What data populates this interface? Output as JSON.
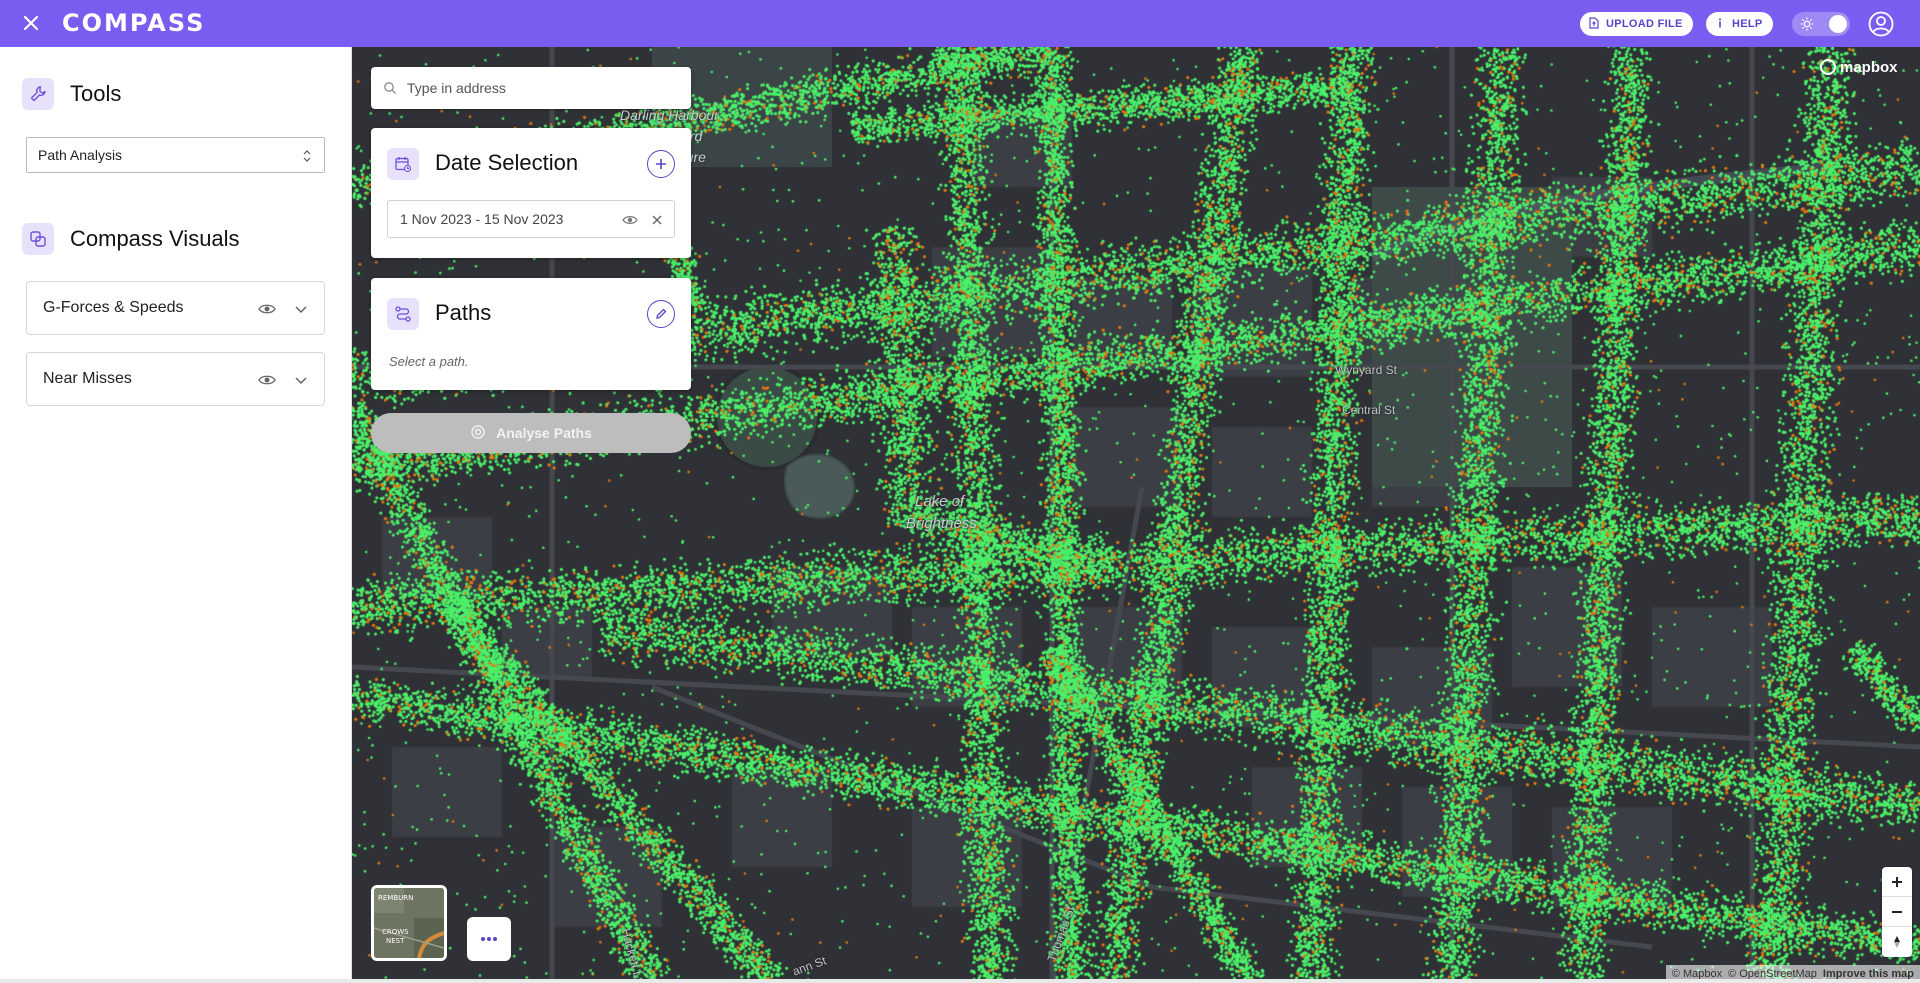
{
  "app": {
    "logo": "COMPASS",
    "accent": "#7b5cf0"
  },
  "header": {
    "close_icon": "close-icon",
    "upload_label": "UPLOAD FILE",
    "help_label": "HELP",
    "theme_icon": "sun-icon",
    "account_icon": "account-circle-icon"
  },
  "sidebar": {
    "tools_title": "Tools",
    "tool_select_value": "Path Analysis",
    "visuals_title": "Compass Visuals",
    "layers": [
      {
        "label": "G-Forces & Speeds"
      },
      {
        "label": "Near Misses"
      }
    ]
  },
  "map": {
    "search_placeholder": "Type in address",
    "date_panel": {
      "title": "Date Selection",
      "range": "1 Nov 2023 - 15 Nov 2023"
    },
    "paths_panel": {
      "title": "Paths",
      "placeholder": "Select a path."
    },
    "analyse_label": "Analyse Paths",
    "mapbox_logo": "mapbox",
    "attribution": {
      "mapbox": "© Mapbox",
      "osm": "© OpenStreetMap",
      "improve": "Improve this map"
    },
    "labels": {
      "darling": "Darling Harbour",
      "ard": "ard",
      "ature": "ature",
      "lake1": "Lake of",
      "lake2": "Brightness",
      "wynyard": "Wynyard St",
      "central": "Central St",
      "hackett": "Hackett L",
      "ann": "ann St",
      "thomas": "Thomas St",
      "minimap_1": "REMBURN",
      "minimap_2": "CROWS",
      "minimap_3": "NEST"
    },
    "point_colors": {
      "normal": "#4cf06a",
      "near_miss": "#e07a12"
    }
  }
}
